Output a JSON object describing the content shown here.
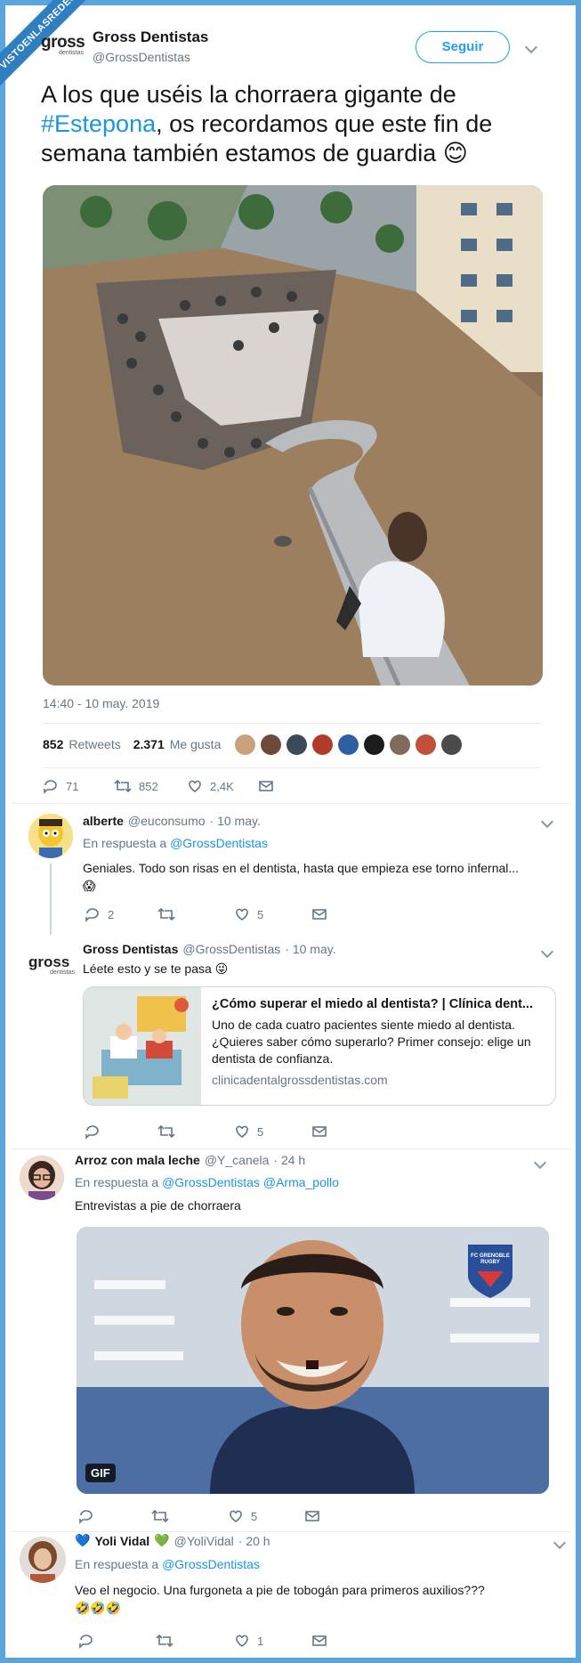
{
  "watermark": "VISTOENLASREDES",
  "tweet": {
    "author_name": "Gross Dentistas",
    "handle": "@GrossDentistas",
    "logo_text": "gross",
    "logo_sub": "dentistas",
    "follow_label": "Seguir",
    "text_before": "A los que uséis la chorraera gigante de ",
    "hashtag": "#Estepona",
    "text_after": ", os recordamos que este fin de semana también estamos de guardia ",
    "emoji": "😊",
    "timestamp": "14:40 - 10 may. 2019",
    "retweets_count": "852",
    "retweets_label": "Retweets",
    "likes_count": "2.371",
    "likes_label": "Me gusta",
    "actions": {
      "replies": "71",
      "retweets": "852",
      "likes": "2,4K"
    }
  },
  "replies": [
    {
      "name": "alberte",
      "handle": "@euconsumo",
      "date": "· 10 may.",
      "in_reply_label": "En respuesta a",
      "in_reply_to": "@GrossDentistas",
      "text": "Geniales. Todo son risas en el dentista, hasta que empieza ese torno infernal...",
      "emoji": "😱",
      "actions": {
        "replies": "2",
        "retweets": "",
        "likes": "5"
      }
    },
    {
      "name": "Gross Dentistas",
      "handle": "@GrossDentistas",
      "date": "· 10 may.",
      "text": "Léete esto y se te pasa",
      "emoji": "😜",
      "card": {
        "title": "¿Cómo superar el miedo al dentista? | Clínica dent...",
        "description": "Uno de cada cuatro pacientes siente miedo al dentista. ¿Quieres saber cómo superarlo? Primer consejo: elige un dentista de confianza.",
        "domain": "clinicadentalgrossdentistas.com"
      },
      "actions": {
        "replies": "",
        "retweets": "",
        "likes": "5"
      }
    },
    {
      "name": "Arroz con mala leche",
      "handle": "@Y_canela",
      "date": "· 24 h",
      "in_reply_label": "En respuesta a",
      "in_reply_to": "@GrossDentistas @Arma_pollo",
      "text": "Entrevistas a pie de chorraera",
      "gif_label": "GIF",
      "crest_text": "FC GRENOBLE RUGBY",
      "actions": {
        "replies": "",
        "retweets": "",
        "likes": "5"
      }
    },
    {
      "name_prefix_emoji": "💙",
      "name": "Yoli Vidal",
      "name_suffix_emoji": "💚",
      "handle": "@YoliVidal",
      "date": "· 20 h",
      "in_reply_label": "En respuesta a",
      "in_reply_to": "@GrossDentistas",
      "text": "Veo el negocio.  Una furgoneta a pie de tobogán para primeros auxilios???",
      "emoji_line": "🤣🤣🤣",
      "actions": {
        "replies": "",
        "retweets": "",
        "likes": "1"
      }
    }
  ],
  "colors": {
    "accent": "#1da1f2",
    "link": "#1b95e0",
    "muted": "#657786",
    "frame": "#5aa5dc"
  }
}
